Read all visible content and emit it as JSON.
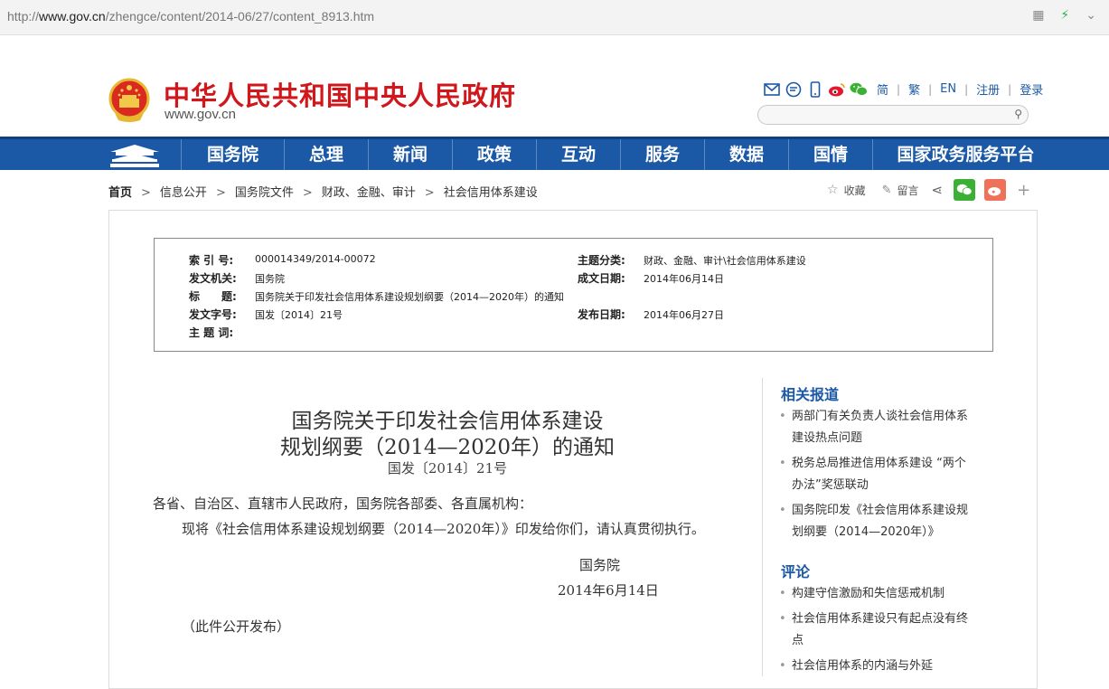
{
  "browser": {
    "url_prefix": "http://",
    "url_domain": "www.gov.cn",
    "url_path": "/zhengce/content/2014-06/27/content_8913.htm"
  },
  "header": {
    "site_title": "中华人民共和国中央人民政府",
    "site_url": "www.gov.cn",
    "lang_simplified": "简",
    "lang_traditional": "繁",
    "lang_en": "EN",
    "register": "注册",
    "login": "登录",
    "colors": {
      "brand_red": "#d0171c",
      "nav_blue": "#1b58a6"
    }
  },
  "nav": {
    "items": [
      "国务院",
      "总理",
      "新闻",
      "政策",
      "互动",
      "服务",
      "数据",
      "国情",
      "国家政务服务平台"
    ]
  },
  "breadcrumb": {
    "home": "首页",
    "items": [
      "信息公开",
      "国务院文件",
      "财政、金融、审计",
      "社会信用体系建设"
    ],
    "arrow": ">"
  },
  "share": {
    "favorite": "收藏",
    "comment": "留言",
    "plus": "+"
  },
  "meta": {
    "index_label": "索 引 号:",
    "index_value": "000014349/2014-00072",
    "topic_label": "主题分类:",
    "topic_value": "财政、金融、审计\\社会信用体系建设",
    "issuer_label": "发文机关:",
    "issuer_value": "国务院",
    "written_label": "成文日期:",
    "written_value": "2014年06月14日",
    "title_label": "标　　题:",
    "title_value": "国务院关于印发社会信用体系建设规划纲要（2014—2020年）的通知",
    "docno_label": "发文字号:",
    "docno_value": "国发〔2014〕21号",
    "published_label": "发布日期:",
    "published_value": "2014年06月27日",
    "keywords_label": "主 题 词:"
  },
  "article": {
    "title_line1": "国务院关于印发社会信用体系建设",
    "title_line2": "规划纲要（2014—2020年）的通知",
    "doc_number": "国发〔2014〕21号",
    "salutation": "各省、自治区、直辖市人民政府，国务院各部委、各直属机构：",
    "body": "现将《社会信用体系建设规划纲要（2014—2020年）》印发给你们，请认真贯彻执行。",
    "signer": "国务院",
    "date": "2014年6月14日",
    "note": "（此件公开发布）"
  },
  "sidebar": {
    "related_title": "相关报道",
    "related": [
      [
        "两部门有关负责人谈社会信用体系",
        "建设热点问题"
      ],
      [
        "税务总局推进信用体系建设 “两个",
        "办法”奖惩联动"
      ],
      [
        "国务院印发《社会信用体系建设规",
        "划纲要（2014—2020年）》"
      ]
    ],
    "comment_title": "评论",
    "comments": [
      [
        "构建守信激励和失信惩戒机制"
      ],
      [
        "社会信用体系建设只有起点没有终",
        "点"
      ],
      [
        "社会信用体系的内涵与外延"
      ]
    ]
  }
}
